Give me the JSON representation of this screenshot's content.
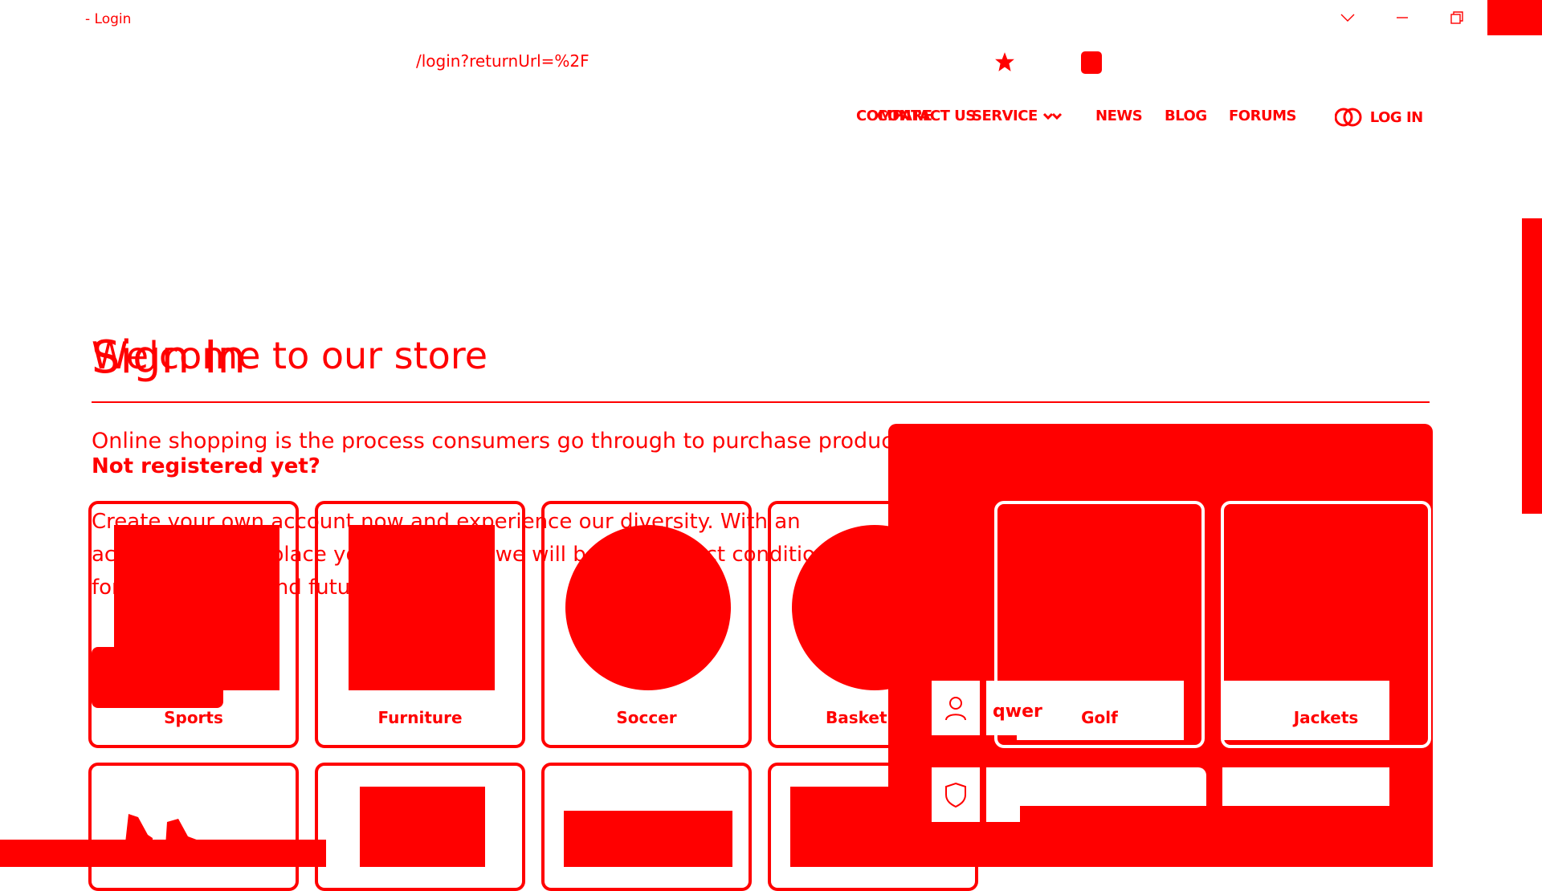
{
  "window": {
    "title": "Login",
    "prefix": "-"
  },
  "address_bar": {
    "url": "/login?returnUrl=%2F"
  },
  "nav": {
    "items": [
      "CONTACT US",
      "SERVICE",
      "NEWS",
      "BLOG",
      "FORUMS",
      "LOG IN"
    ],
    "ghost_items": [
      "COMPARE",
      "SERVICE",
      "NEWS",
      "BLOG",
      "FORUMS",
      "LOG IN"
    ]
  },
  "heading": {
    "sign_in": "Sign In",
    "welcome": "Welcome to our store"
  },
  "intro": {
    "line1": "Online shopping is the process consumers go through to purchase products or services",
    "not_registered": "Not registered yet?",
    "create_account": "Create your own account now and experience our diversity. With an account you can place your order and we will be in a perfect condition for your current and future pr"
  },
  "categories": [
    {
      "label": "Sports"
    },
    {
      "label": "Furniture"
    },
    {
      "label": "Soccer"
    },
    {
      "label": "Basketball"
    },
    {
      "label": "Golf"
    },
    {
      "label": "Jackets"
    }
  ],
  "login_form": {
    "username_value": "qwer",
    "password_value": "•••••"
  },
  "colors": {
    "accent": "#ff0000",
    "background": "#ffffff"
  },
  "icons": {
    "star": "star-icon",
    "user": "user-icon",
    "shield": "shield-icon",
    "globe": "globe-icon"
  }
}
